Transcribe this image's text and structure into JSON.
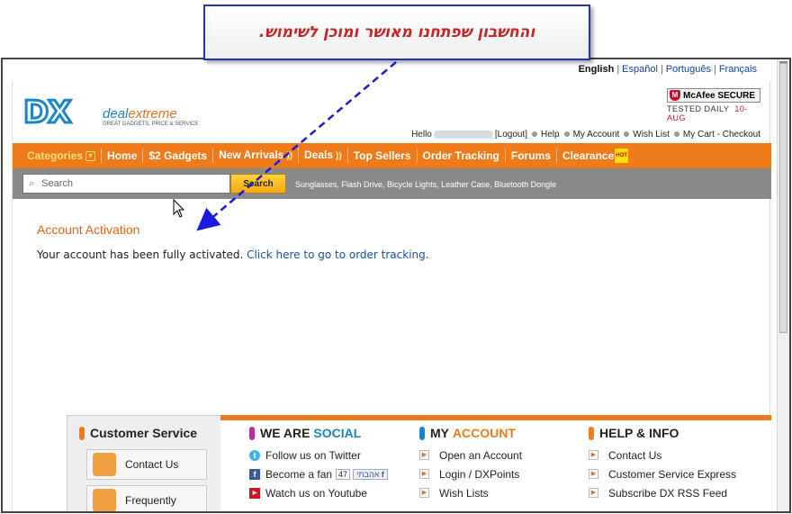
{
  "annotation": {
    "text": "והחשבון שפתחנו מאושר ומוכן לשימוש."
  },
  "languages": {
    "active": "English",
    "others": [
      "Español",
      "Português",
      "Français"
    ]
  },
  "logo": {
    "mark": "DX",
    "brand_a": "deal",
    "brand_b": "extreme",
    "tagline": "GREAT GADGETS, PRICE & SERVICE"
  },
  "mcafee": {
    "label": "McAfee SECURE",
    "tested": "TESTED DAILY",
    "date": "10-AUG"
  },
  "userbar": {
    "hello": "Hello",
    "logout": "[Logout]",
    "help": "Help",
    "my_account": "My Account",
    "wish_list": "Wish List",
    "cart": "My Cart - Checkout"
  },
  "nav": {
    "categories": "Categories",
    "home": "Home",
    "gadgets": "$2 Gadgets",
    "new_arrivals": "New Arrivals",
    "deals": "Deals",
    "top_sellers": "Top Sellers",
    "order_tracking": "Order Tracking",
    "forums": "Forums",
    "clearance": "Clearance",
    "hot_badge": "HOT"
  },
  "search": {
    "placeholder": "Search",
    "button": "Search",
    "popular": "Sunglasses, Flash Drive, Bicycle Lights, Leather Case, Bluetooth Dongle"
  },
  "content": {
    "title": "Account Activation",
    "message": "Your account has been fully activated.",
    "link": "Click here to go to order tracking."
  },
  "footer": {
    "customer_service": {
      "title": "Customer Service",
      "contact": "Contact Us",
      "frequently": "Frequently"
    },
    "social": {
      "title_a": "WE ARE",
      "title_b": "SOCIAL",
      "twitter": "Follow us on Twitter",
      "fan": "Become a fan",
      "fan_count": "47",
      "like": "אהבתי",
      "youtube": "Watch us on Youtube"
    },
    "account": {
      "title_a": "MY",
      "title_b": "ACCOUNT",
      "open": "Open an Account",
      "login": "Login / DXPoints",
      "wish": "Wish Lists"
    },
    "help": {
      "title": "HELP & INFO",
      "contact": "Contact Us",
      "express": "Customer Service Express",
      "rss": "Subscribe DX RSS Feed"
    }
  },
  "colors": {
    "orange": "#f07b1a",
    "blue": "#1a86c9",
    "callout_border": "#2233bb",
    "callout_text": "#cc2222"
  }
}
